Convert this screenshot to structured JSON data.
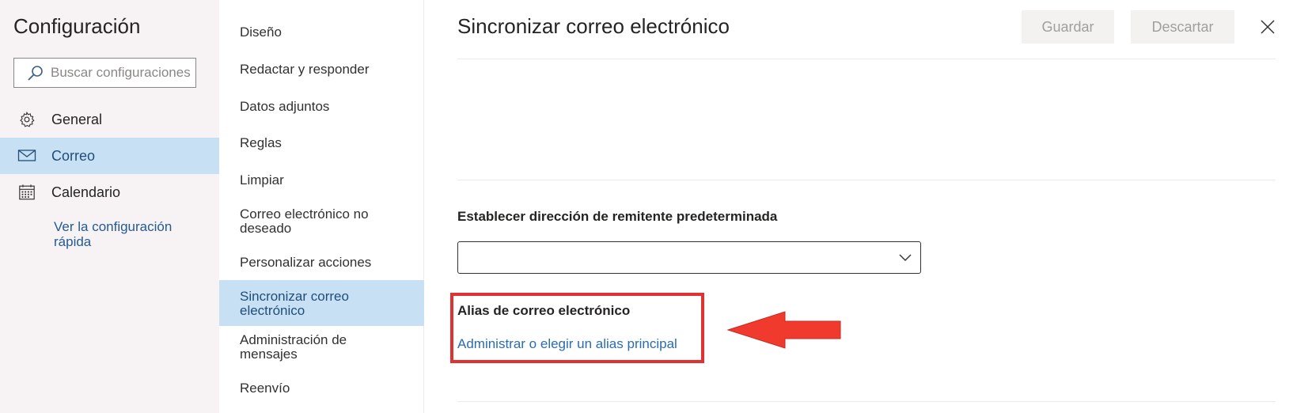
{
  "settings": {
    "title": "Configuración",
    "search_placeholder": "Buscar configuraciones",
    "nav": [
      {
        "label": "General",
        "icon": "gear-icon"
      },
      {
        "label": "Correo",
        "icon": "mail-icon",
        "active": true
      },
      {
        "label": "Calendario",
        "icon": "calendar-icon"
      }
    ],
    "quick_link": "Ver la configuración rápida"
  },
  "mail_menu": {
    "items": [
      "Diseño",
      "Redactar y responder",
      "Datos adjuntos",
      "Reglas",
      "Limpiar",
      "Correo electrónico no deseado",
      "Personalizar acciones",
      "Sincronizar correo electrónico",
      "Administración de mensajes",
      "Reenvío"
    ],
    "active_index": 7
  },
  "content": {
    "title": "Sincronizar correo electrónico",
    "save_label": "Guardar",
    "discard_label": "Descartar",
    "default_sender_label": "Establecer dirección de remitente predeterminada",
    "default_sender_value": "",
    "alias_title": "Alias de correo electrónico",
    "alias_link": "Administrar o elegir un alias principal"
  },
  "colors": {
    "active_bg": "#c7e0f4",
    "link": "#2b6cb0",
    "highlight": "#e03232"
  }
}
